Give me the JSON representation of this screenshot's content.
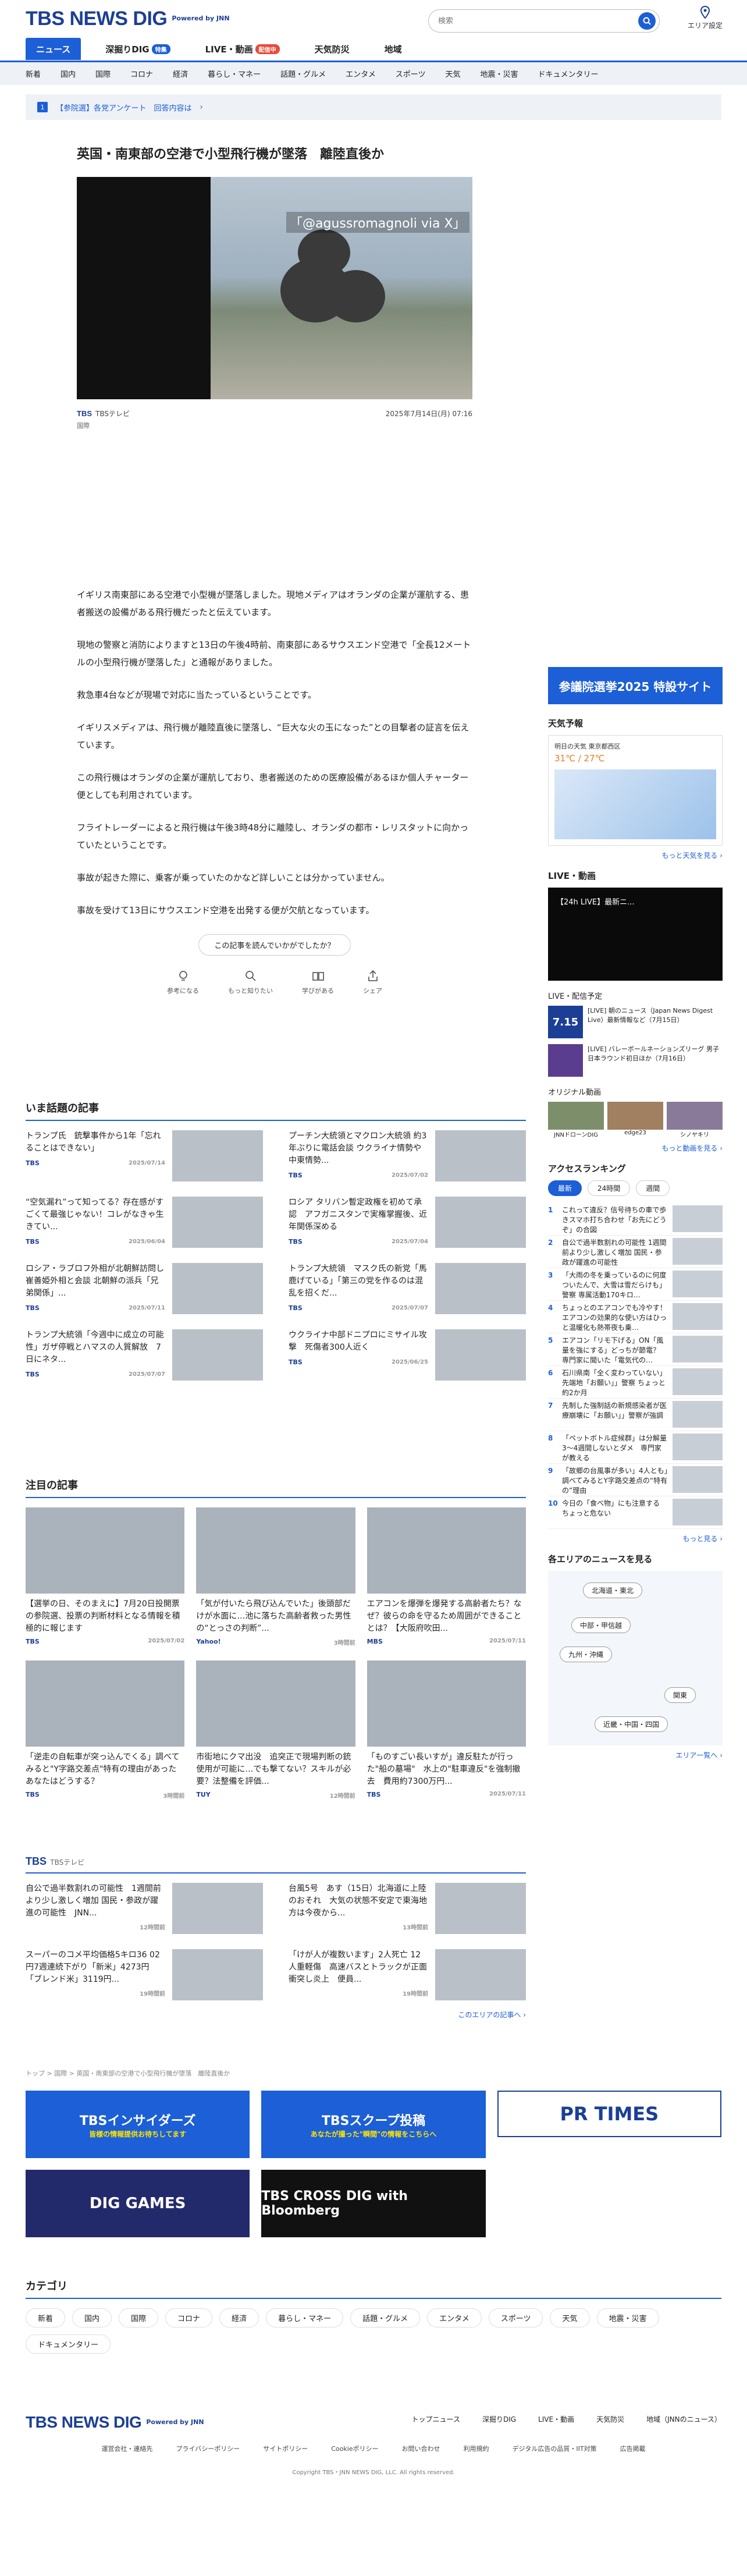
{
  "header": {
    "logo": "TBS NEWS DIG",
    "powered": "Powered by JNN",
    "search_placeholder": "検索",
    "area_label": "エリア設定"
  },
  "main_nav": [
    {
      "label": "ニュース",
      "active": true
    },
    {
      "label": "深掘りDIG",
      "badge": "特集"
    },
    {
      "label": "LIVE・動画",
      "badge": "配信中"
    },
    {
      "label": "天気防災"
    },
    {
      "label": "地域"
    }
  ],
  "sub_nav": [
    "新着",
    "国内",
    "国際",
    "コロナ",
    "経済",
    "暮らし・マネー",
    "話題・グルメ",
    "エンタメ",
    "スポーツ",
    "天気",
    "地震・災害",
    "ドキュメンタリー"
  ],
  "notice": {
    "num": "1",
    "text": "【参院選】各党アンケート　回答内容は",
    "arrow": "›"
  },
  "article": {
    "title": "英国・南東部の空港で小型飛行機が墜落　離陸直後か",
    "photo_caption": "「@agussromagnoli via X」",
    "source": "TBSテレビ",
    "date": "2025年7月14日(月) 07:16",
    "category": "国際",
    "paragraphs": [
      "イギリス南東部にある空港で小型機が墜落しました。現地メディアはオランダの企業が運航する、患者搬送の設備がある飛行機だったと伝えています。",
      "現地の警察と消防によりますと13日の午後4時前、南東部にあるサウスエンド空港で「全長12メートルの小型飛行機が墜落した」と通報がありました。",
      "救急車4台などが現場で対応に当たっているということです。",
      "イギリスメディアは、飛行機が離陸直後に墜落し、“巨大な火の玉になった”との目撃者の証言を伝えています。",
      "この飛行機はオランダの企業が運航しており、患者搬送のための医療設備があるほか個人チャーター便としても利用されています。",
      "フライトレーダーによると飛行機は午後3時48分に離陸し、オランダの都市・レリスタットに向かっていたということです。",
      "事故が起きた際に、乗客が乗っていたのかなど詳しいことは分かっていません。",
      "事故を受けて13日にサウスエンド空港を出発する便が欠航となっています。"
    ],
    "feedback_q": "この記事を読んでいかがでしたか？",
    "feedback": [
      "参考になる",
      "もっと知りたい",
      "学びがある",
      "シェア"
    ]
  },
  "side": {
    "election": "参議院選挙2025 特設サイト",
    "weather_title": "天気予報",
    "weather_loc": "明日の天気 東京都西区",
    "weather_temp": "31℃ / 27℃",
    "weather_more": "もっと天気を見る ›",
    "live_title": "LIVE・動画",
    "live_thumb": "【24h LIVE】最新ニ...",
    "live_schedule": "LIVE・配信予定",
    "live_items": [
      {
        "date": "7.15",
        "text": "[LIVE] 朝のニュース（Japan News Digest Live）最新情報など（7月15日）"
      },
      {
        "date": "",
        "text": "[LIVE] バレーボールネーションズリーグ 男子日本ラウンド初日ほか（7月16日）"
      }
    ],
    "orig_title": "オリジナル動画",
    "orig_items": [
      "JNNドローンDIG",
      "edge23",
      "シノヤキリ"
    ],
    "orig_more": "もっと動画を見る ›",
    "rank_title": "アクセスランキング",
    "rank_tabs": [
      "最新",
      "24時間",
      "週間"
    ],
    "ranking": [
      "これって違反？信号待ちの車で歩きスマホ打ち合わせ「お先にどうぞ」の合図",
      "自公で過半数割れの可能性 1週間前より少し激しく増加 国民・参政が躍進の可能性",
      "「大雨の冬を乗っているのに何度ついたんで、大雪は雪だらけも」警察 専属活動170キロ…",
      "ちょっとのエアコンでも冷やす！エアコンの効果的な使い方はひっと温暖化も熱帯夜も乗…",
      "エアコン「リモ下げる」ON「風量を強にする」どっちが節電？ 専門家に聞いた「電気代の…",
      "石川県南「全く変わっていない」先端地「お願い」」警察 ちょっと約2か月",
      "先制した強制話の新規感染者が医療崩壊に「お願い」」警察が強調",
      "「ペットボトル症候群」は分解量3～4週間しないとダメ　専門家が教える",
      "「故郷の台風事が多い」4人とも」調べてみるとY字路交差点の“特有の”理由",
      "今日の「食べ物」にも注意する ちょっと危ない"
    ],
    "rank_more": "もっと見る ›",
    "area_title": "各エリアのニュースを見る",
    "areas": [
      "北海道・東北",
      "中部・甲信越",
      "九州・沖縄",
      "関東",
      "近畿・中国・四国"
    ],
    "area_more": "エリア一覧へ ›"
  },
  "hot_title": "いま話題の記事",
  "hot": [
    {
      "t": "トランプ氏　銃撃事件から1年「忘れることはできない」",
      "src": "TBS",
      "d": "2025/07/14"
    },
    {
      "t": "プーチン大統領とマクロン大統領 約3年ぶりに電話会談 ウクライナ情勢や中東情勢...",
      "src": "TBS",
      "d": "2025/07/02"
    },
    {
      "t": "“空気漏れ”って知ってる？存在感がすごくて最強じゃない！コレがなきゃ生きてい...",
      "src": "TBS",
      "d": "2025/06/04"
    },
    {
      "t": "ロシア タリバン暫定政権を初めて承認　アフガニスタンで実権掌握後、近年関係深める",
      "src": "TBS",
      "d": "2025/07/04"
    },
    {
      "t": "ロシア・ラブロフ外相が北朝鮮訪問し崔善姫外相と会談 北朝鮮の派兵「兄弟関係」...",
      "src": "TBS",
      "d": "2025/07/11"
    },
    {
      "t": "トランプ大統領　マスク氏の新党「馬鹿げている」「第三の党を作るのは混乱を招くだ...",
      "src": "TBS",
      "d": "2025/07/07"
    },
    {
      "t": "トランプ大統領「今週中に成立の可能性」ガザ停戦とハマスの人質解放　7日にネタ...",
      "src": "TBS",
      "d": "2025/07/07"
    },
    {
      "t": "ウクライナ中部ドニプロにミサイル攻撃　死傷者300人近く",
      "src": "TBS",
      "d": "2025/06/25"
    }
  ],
  "featured_title": "注目の記事",
  "featured": [
    {
      "t": "【選挙の日、そのまえに】7月20日投開票の参院選、投票の判断材料となる情報を積極的に報じます",
      "src": "TBS",
      "d": "2025/07/02"
    },
    {
      "t": "「気が付いたら飛び込んでいた」後頭部だけが水面に…池に落ちた高齢者救った男性の“とっさの判断”...",
      "src": "Yahoo!",
      "d": "3時間前"
    },
    {
      "t": "エアコンを爆弾を爆発する高齢者たち？なぜ？彼らの命を守るため周囲ができることとは？【大阪府吹田...",
      "src": "MBS",
      "d": "2025/07/11"
    },
    {
      "t": "「逆走の自転車が突っ込んでくる」調べてみると\"Y字路交差点\"特有の理由があった あなたはどうする？",
      "src": "TBS",
      "d": "3時間前"
    },
    {
      "t": "市街地にクマ出没　追突正で現場判断の銃使用が可能に…でも撃てない？スキルが必要？法整備を評価...",
      "src": "TUY",
      "d": "12時間前"
    },
    {
      "t": "「ものすごい長いすが」違反駐たが行った\"船の墓場\"　水上の\"駐車違反\"を強制撤去　費用約7300万円...",
      "src": "TBS",
      "d": "2025/07/11"
    }
  ],
  "tbs_title": "TBS",
  "tbs_sub": "TBSテレビ",
  "tbs_items": [
    {
      "t": "自公で過半数割れの可能性　1週間前より少し激しく増加 国民・参政が躍進の可能性　JNN...",
      "d": "12時間前"
    },
    {
      "t": "台風5号　あす（15日）北海道に上陸のおそれ　大気の状態不安定で東海地方は今夜から...",
      "d": "13時間前"
    },
    {
      "t": "スーパーのコメ平均価格5キロ36 02円7週連続下がり「新米」4273円「ブレンド米」3119円...",
      "d": "19時間前"
    },
    {
      "t": "「けが人が複数います」2人死亡 12人重軽傷　高速バスとトラックが正面衝突し炎上　便員...",
      "d": "19時間前"
    }
  ],
  "tbs_more": "このエリアの記事へ ›",
  "breadcrumb": "トップ > 国際 > 英国・南東部の空港で小型飛行機が墜落　離陸直後か",
  "banners": [
    "TBSインサイダーズ",
    "TBSスクープ投稿",
    "PR TIMES",
    "DIG GAMES",
    "TBS CROSS DIG with Bloomberg"
  ],
  "banner_subs": [
    "皆様の情報提供お待ちしてます",
    "あなたが撮った\"瞬間\"の情報をこちらへ"
  ],
  "category_title": "カテゴリ",
  "categories": [
    "新着",
    "国内",
    "国際",
    "コロナ",
    "経済",
    "暮らし・マネー",
    "話題・グルメ",
    "エンタメ",
    "スポーツ",
    "天気",
    "地震・災害",
    "ドキュメンタリー"
  ],
  "footer": {
    "nav": [
      "トップニュース",
      "深掘りDIG",
      "LIVE・動画",
      "天気防災",
      "地域（JNNのニュース）"
    ],
    "links": [
      "運営会社・連絡先",
      "プライバシーポリシー",
      "サイトポリシー",
      "Cookieポリシー",
      "お問い合わせ",
      "利用規約",
      "デジタル広告の品質・IIT対策",
      "広告掲載"
    ],
    "copyright": "Copyright TBS・JNN NEWS DIG, LLC. All rights reserved."
  }
}
